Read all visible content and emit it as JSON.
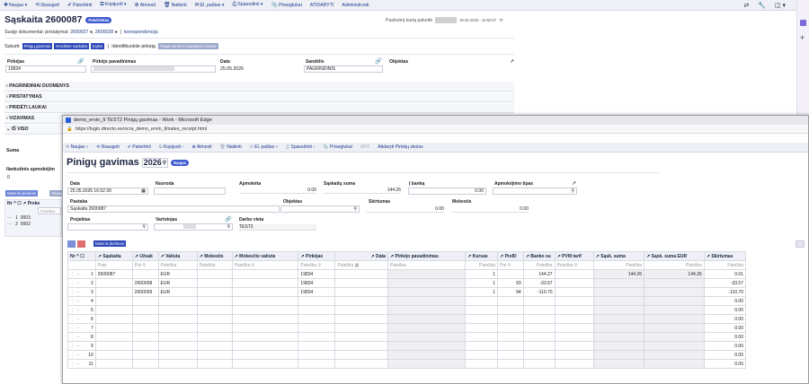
{
  "toolbar": {
    "new": "Naujas",
    "save": "Išsaugoti",
    "confirm": "Patvirtinti",
    "copy": "Kopijuoti",
    "cancel": "Atmesti",
    "delete": "Naikinti",
    "email": "El. paštas",
    "print": "Spausdinti",
    "attachments": "Prisegtukai",
    "open": "ATIDARYTI",
    "admin": "Administruoti"
  },
  "main": {
    "title": "Sąskaita 2600087",
    "status_badge": "Patvirtintas",
    "last_changed_label": "Paskutinį kartą pakeitė",
    "last_changed_time": "25.05.2026 - 16:52:07",
    "related_docs_label": "Susiję dokumentai: pristatymai:",
    "related_doc_1": "2600027",
    "related_doc_2": "2600028",
    "related_correspondence": "korespondencija",
    "create_label": "Sukurti:",
    "create_buttons": [
      "Pinigų gavimas",
      "Kreditinė sąskaita",
      "Įvykis"
    ],
    "identify_label": "Identifikuokite pirkėją:",
    "identify_button": "Pagal asmens tapatybės kortelę",
    "fields": {
      "customer_label": "Pirkėjas",
      "customer_value": "19834",
      "customer_name_label": "Pirkėjo pavadinimas",
      "date_label": "Data",
      "date_value": "25.05.2026",
      "warehouse_label": "Sandėlis",
      "warehouse_value": "PAGRINDINIS",
      "object_label": "Objektas"
    },
    "sections": [
      "PAGRINDINIAI DUOMENYS",
      "PRISTATYMAS",
      "PRIDĖTI LAUKAI",
      "VIZAVIMAS",
      "IŠ VISO"
    ],
    "left_side": {
      "sum_label": "Suma",
      "payment_label": "Ilankstinis apmokėjim",
      "payment_value": "0",
      "mass_edit": "Masinis įkėlimas",
      "mass_edit_2": "Atnaujin",
      "col_nr": "Nr",
      "col_product": "Preke",
      "search_placeholder": "Paieška",
      "rows": [
        {
          "nr": "1",
          "code": "0003"
        },
        {
          "nr": "2",
          "code": "0002"
        }
      ]
    }
  },
  "popup": {
    "window_title": "demo_ervin_lt TEST2 Pinigų gavimas - Work - Microsoft Edge",
    "url": "https://login.directo.ee/ocra_demo_ervin_lt/sales_receipt.html",
    "toolbar": {
      "new": "Naujas",
      "save": "Išsaugoti",
      "confirm": "Patvirtinti",
      "copy": "Kopijuoti",
      "cancel": "Atmesti",
      "delete": "Naikinti",
      "email": "El. paštas",
      "print": "Spausdinti",
      "attachments": "Prisegtukai",
      "xpo": "XPO",
      "settle": "Atidaryti Pirkėjų skolas"
    },
    "title": "Pinigų gavimas",
    "year": "2026",
    "status_badge": "Naujas",
    "fields": {
      "date_label": "Data",
      "date_value": "25.05.2026 16:52:39",
      "reference_label": "Nuoroda",
      "paid_label": "Apmokėta",
      "paid_value": "0.00",
      "invoice_sum_label": "Sąskaitų suma",
      "invoice_sum_value": "144.26",
      "to_bank_label": "Į banką",
      "to_bank_value": "0.00",
      "payment_type_label": "Apmokėjimo tipas",
      "comment_label": "Pastaba",
      "comment_value": "Sąskaita 2600087",
      "object_label": "Objektas",
      "difference_label": "Skirtumas",
      "difference_value": "0.00",
      "fee_label": "Mokestis",
      "fee_value": "0.00",
      "project_label": "Projektas",
      "user_label": "Vartotojas",
      "workplace_label": "Darbo vieta",
      "workplace_value": "TEST2"
    },
    "mass_edit": "Masinis įkėlimas",
    "columns": [
      "Nr",
      "Sąskaita",
      "Užsakymas",
      "Valiuta",
      "Mokestis",
      "Mokesčio valiuta",
      "Pirkėjas",
      "Data",
      "Pirkėjo pavadinimas",
      "Kursas",
      "PreID",
      "Banko su",
      "PVM tarif",
      "Sąsk. suma",
      "Sąsk. suma EUR",
      "Skirtumas"
    ],
    "col_headers_short": [
      "Nr",
      "Sąskaita",
      "Užsak",
      "Valiuta",
      "Mokestis",
      "Mokesčio valiuta",
      "Pirkėjas",
      "Data",
      "Pirkėjo pavadinimas",
      "Kursas",
      "PreID",
      "Banko su",
      "PVM tarif",
      "Sąsk. suma",
      "Sąsk. suma EUR",
      "Skirtumas"
    ],
    "filter_placeholder": "Paieška",
    "filter_short": "Paie",
    "filter_short2": "Pai",
    "rows": [
      {
        "nr": "1",
        "invoice": "2600087",
        "order": "",
        "currency": "EUR",
        "customer": "19834",
        "rate": "1",
        "preid": "",
        "bank_sum": "144.27",
        "inv_sum": "144.26",
        "inv_sum_eur": "144.26",
        "difference": "0.01"
      },
      {
        "nr": "2",
        "invoice": "",
        "order": "2600058",
        "currency": "EUR",
        "customer": "19834",
        "rate": "1",
        "preid": "93",
        "bank_sum": "-33.57",
        "inv_sum": "",
        "inv_sum_eur": "",
        "difference": "-33.57"
      },
      {
        "nr": "3",
        "invoice": "",
        "order": "2600059",
        "currency": "EUR",
        "customer": "19834",
        "rate": "1",
        "preid": "94",
        "bank_sum": "-110.70",
        "inv_sum": "",
        "inv_sum_eur": "",
        "difference": "-110.70"
      },
      {
        "nr": "4",
        "difference": "0.00"
      },
      {
        "nr": "5",
        "difference": "0.00"
      },
      {
        "nr": "6",
        "difference": "0.00"
      },
      {
        "nr": "7",
        "difference": "0.00"
      },
      {
        "nr": "8",
        "difference": "0.00"
      },
      {
        "nr": "9",
        "difference": "0.00"
      },
      {
        "nr": "10",
        "difference": "0.00"
      },
      {
        "nr": "11",
        "difference": "0.00"
      }
    ]
  },
  "colors": {
    "accent": "#3f5bd1",
    "toolbar_bg": "#eef0f6"
  }
}
